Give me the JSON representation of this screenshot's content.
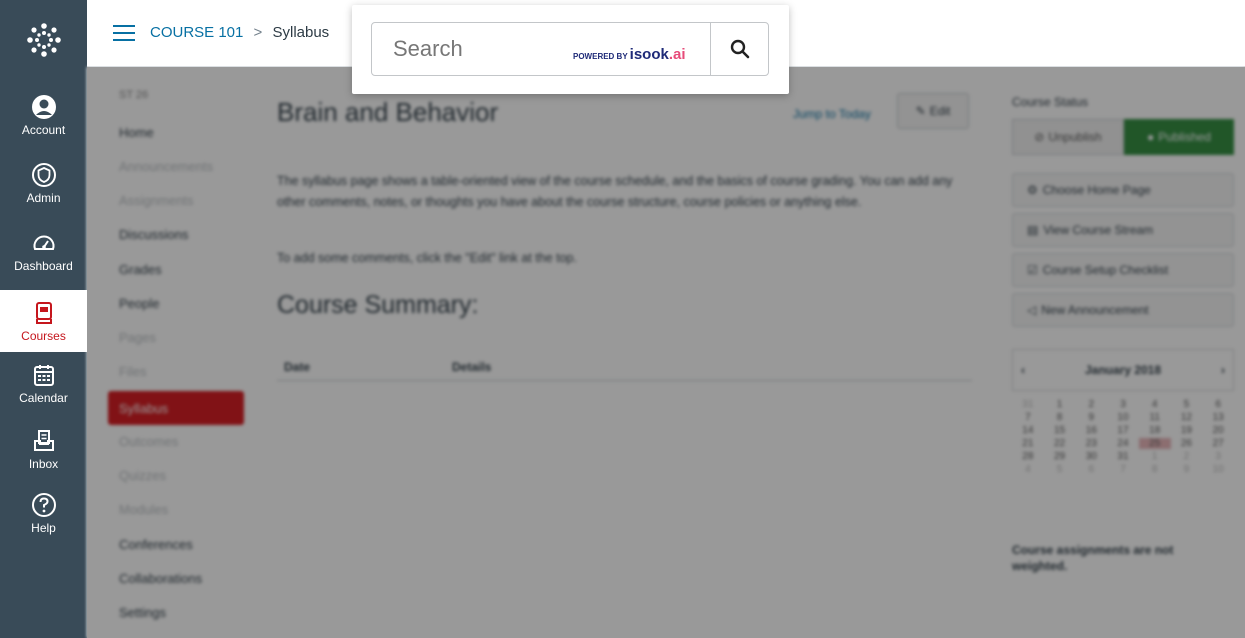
{
  "global_nav": {
    "logo_icon": "canvas-logo-icon",
    "items": [
      {
        "label": "Account",
        "icon": "user-avatar-icon"
      },
      {
        "label": "Admin",
        "icon": "shield-icon"
      },
      {
        "label": "Dashboard",
        "icon": "speedometer-icon"
      },
      {
        "label": "Courses",
        "icon": "book-icon",
        "active": true
      },
      {
        "label": "Calendar",
        "icon": "calendar-icon"
      },
      {
        "label": "Inbox",
        "icon": "inbox-icon"
      },
      {
        "label": "Help",
        "icon": "question-circle-icon"
      }
    ],
    "active_color": "#c5161d",
    "background": "#394b58"
  },
  "breadcrumb": {
    "course": "COURSE 101",
    "separator": ">",
    "current": "Syllabus"
  },
  "search": {
    "placeholder": "Search",
    "powered_by": "POWERED BY",
    "brand_name": "isook",
    "brand_tld": ".ai",
    "button_icon": "magnifier-icon"
  },
  "course_nav": {
    "term": "ST 26",
    "items": [
      {
        "label": "Home",
        "dim": false
      },
      {
        "label": "Announcements",
        "dim": true
      },
      {
        "label": "Assignments",
        "dim": true
      },
      {
        "label": "Discussions",
        "dim": false
      },
      {
        "label": "Grades",
        "dim": false
      },
      {
        "label": "People",
        "dim": false
      },
      {
        "label": "Pages",
        "dim": true
      },
      {
        "label": "Files",
        "dim": true
      },
      {
        "label": "Syllabus",
        "dim": false,
        "selected": true
      },
      {
        "label": "Outcomes",
        "dim": true
      },
      {
        "label": "Quizzes",
        "dim": true
      },
      {
        "label": "Modules",
        "dim": true
      },
      {
        "label": "Conferences",
        "dim": false
      },
      {
        "label": "Collaborations",
        "dim": false
      },
      {
        "label": "Settings",
        "dim": false
      }
    ]
  },
  "content": {
    "title": "Brain and Behavior",
    "jump_link": "Jump to Today",
    "edit_label": "Edit",
    "paragraph_1": "The syllabus page shows a table-oriented view of the course schedule, and the basics of course grading. You can add any other comments, notes, or thoughts you have about the course structure, course policies or anything else.",
    "paragraph_2": "To add some comments, click the \"Edit\" link at the top.",
    "summary_title": "Course Summary:",
    "summary_columns": [
      "Date",
      "Details"
    ]
  },
  "right_sidebar": {
    "status_label": "Course Status",
    "unpublish_label": "Unpublish",
    "published_label": "Published",
    "actions": [
      "Choose Home Page",
      "View Course Stream",
      "Course Setup Checklist",
      "New Announcement"
    ],
    "calendar": {
      "month_label": "January 2018",
      "weeks": [
        [
          "31",
          "1",
          "2",
          "3",
          "4",
          "5",
          "6"
        ],
        [
          "7",
          "8",
          "9",
          "10",
          "11",
          "12",
          "13"
        ],
        [
          "14",
          "15",
          "16",
          "17",
          "18",
          "19",
          "20"
        ],
        [
          "21",
          "22",
          "23",
          "24",
          "25",
          "26",
          "27"
        ],
        [
          "28",
          "29",
          "30",
          "31",
          "1",
          "2",
          "3"
        ],
        [
          "4",
          "5",
          "6",
          "7",
          "8",
          "9",
          "10"
        ]
      ],
      "today": "25"
    },
    "note": "Course assignments are not weighted."
  }
}
